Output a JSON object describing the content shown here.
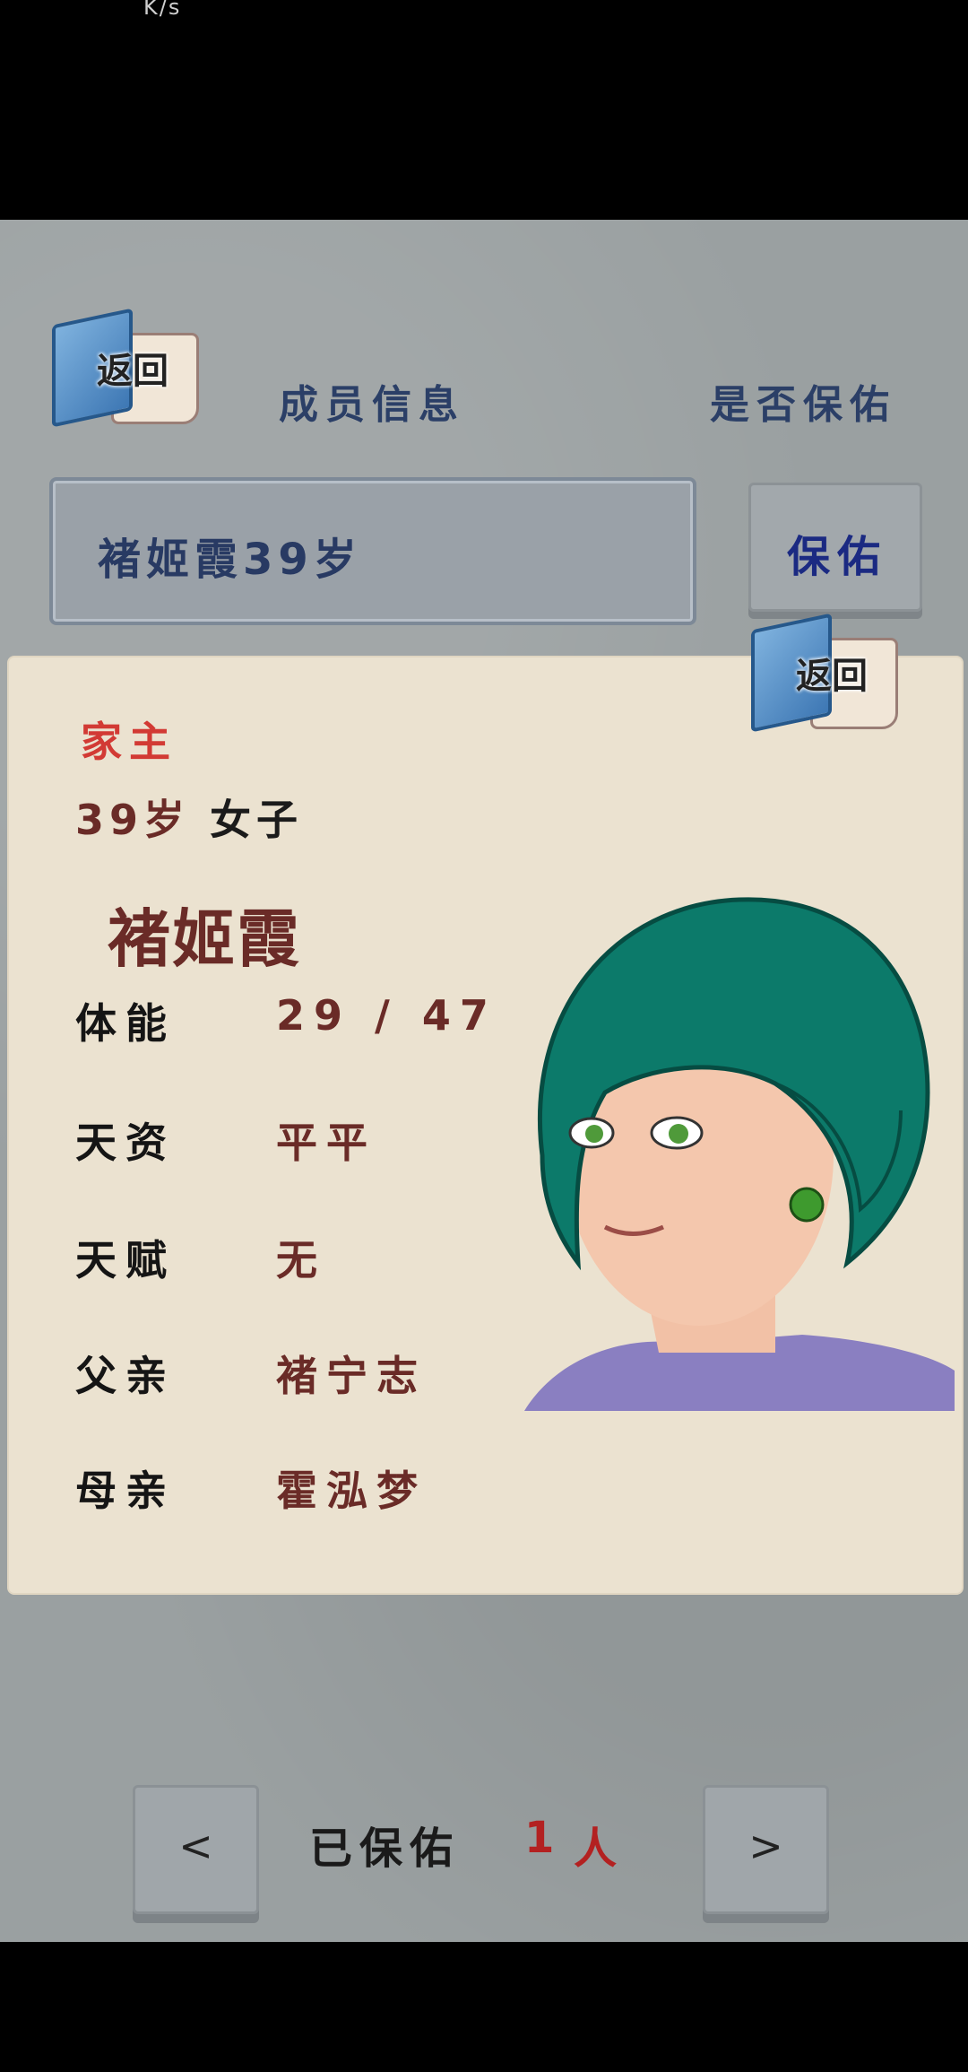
{
  "header": {
    "back_label": "返回",
    "title": "成员信息",
    "protect_question": "是否保佑"
  },
  "member_field": {
    "value": "褚姬霞39岁"
  },
  "protect_button": {
    "label": "保佑"
  },
  "card": {
    "back_label": "返回",
    "rank": "家主",
    "age": "39岁",
    "sex": "女子",
    "name": "褚姬霞",
    "stats": [
      {
        "label": "体能",
        "value": "29 / 47"
      },
      {
        "label": "天资",
        "value": "平平"
      },
      {
        "label": "天赋",
        "value": "无"
      },
      {
        "label": "父亲",
        "value": "褚宁志"
      },
      {
        "label": "母亲",
        "value": "霍泓梦"
      }
    ]
  },
  "footer": {
    "prev_label": "<",
    "next_label": ">",
    "protected_label": "已保佑",
    "protected_count": "1",
    "protected_unit": "人"
  },
  "status_bar": {
    "speed_unit": "K/s"
  },
  "colors": {
    "title": "#2b3f67",
    "accent_red": "#d23a34",
    "value_brown": "#6a2b27",
    "button_blue": "#1b2a82"
  }
}
